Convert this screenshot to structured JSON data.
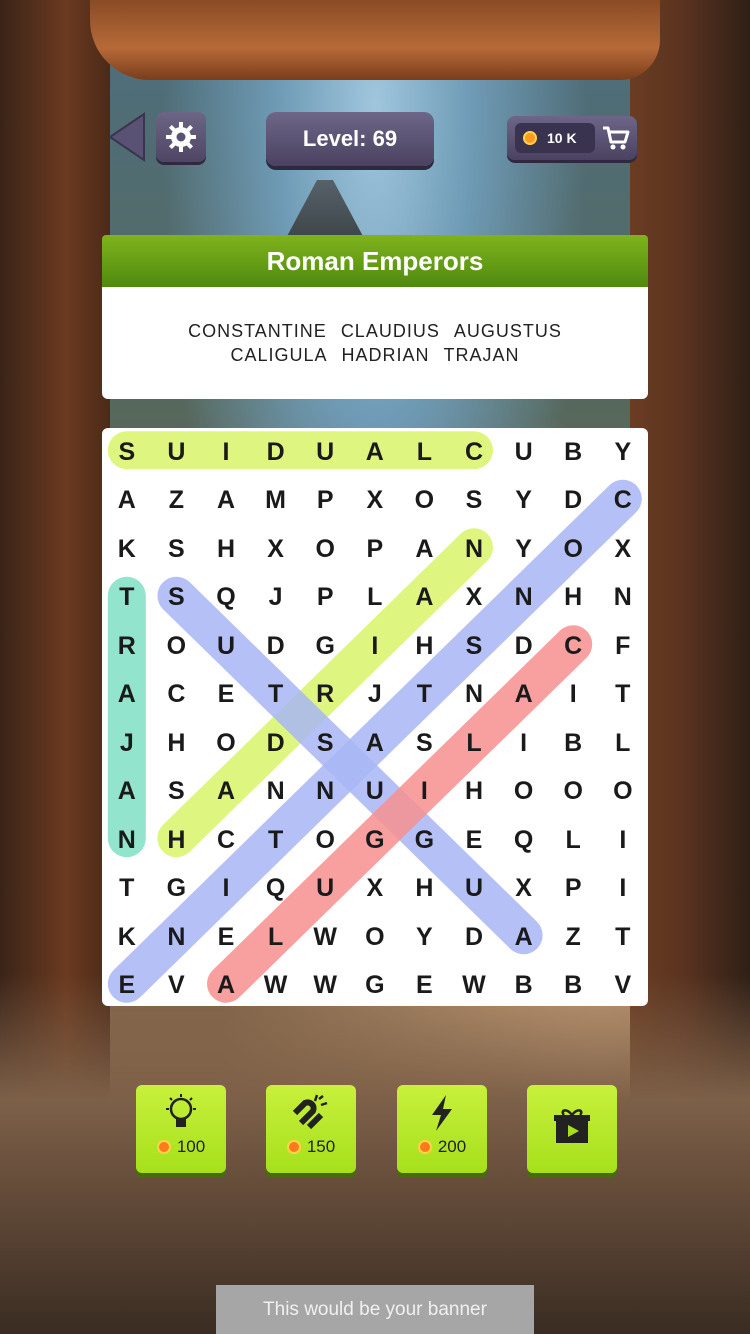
{
  "header": {
    "level_label": "Level: 69",
    "coins": "10 K"
  },
  "category": {
    "title": "Roman Emperors",
    "words_row1": [
      "CONSTANTINE",
      "CLAUDIUS",
      "AUGUSTUS"
    ],
    "words_row2": [
      "CALIGULA",
      "HADRIAN",
      "TRAJAN"
    ]
  },
  "grid": [
    [
      "S",
      "U",
      "I",
      "D",
      "U",
      "A",
      "L",
      "C",
      "U",
      "B",
      "Y"
    ],
    [
      "A",
      "Z",
      "A",
      "M",
      "P",
      "X",
      "O",
      "S",
      "Y",
      "D",
      "C"
    ],
    [
      "K",
      "S",
      "H",
      "X",
      "O",
      "P",
      "A",
      "N",
      "Y",
      "O",
      "X"
    ],
    [
      "T",
      "S",
      "Q",
      "J",
      "P",
      "L",
      "A",
      "X",
      "N",
      "H",
      "N"
    ],
    [
      "R",
      "O",
      "U",
      "D",
      "G",
      "I",
      "H",
      "S",
      "D",
      "C",
      "F"
    ],
    [
      "A",
      "C",
      "E",
      "T",
      "R",
      "J",
      "T",
      "N",
      "A",
      "I",
      "T"
    ],
    [
      "J",
      "H",
      "O",
      "D",
      "S",
      "A",
      "S",
      "L",
      "I",
      "B",
      "L"
    ],
    [
      "A",
      "S",
      "A",
      "N",
      "N",
      "U",
      "I",
      "H",
      "O",
      "O",
      "O"
    ],
    [
      "N",
      "H",
      "C",
      "T",
      "O",
      "G",
      "G",
      "E",
      "Q",
      "L",
      "I"
    ],
    [
      "T",
      "G",
      "I",
      "Q",
      "U",
      "X",
      "H",
      "U",
      "X",
      "P",
      "I"
    ],
    [
      "K",
      "N",
      "E",
      "L",
      "W",
      "O",
      "Y",
      "D",
      "A",
      "Z",
      "T"
    ],
    [
      "E",
      "V",
      "A",
      "W",
      "W",
      "G",
      "E",
      "W",
      "B",
      "B",
      "V"
    ]
  ],
  "highlights": [
    {
      "word": "CLAUDIUS",
      "color": "#d9f56a",
      "from": [
        0,
        7
      ],
      "to": [
        0,
        0
      ]
    },
    {
      "word": "TRAJAN",
      "color": "#7fe0c4",
      "from": [
        3,
        0
      ],
      "to": [
        8,
        0
      ]
    },
    {
      "word": "HADRIAN",
      "color": "#d9f56a",
      "from": [
        8,
        1
      ],
      "to": [
        2,
        7
      ]
    },
    {
      "word": "AUGUSTUS",
      "color": "#a9b7f5",
      "from": [
        10,
        8
      ],
      "to": [
        3,
        1
      ]
    },
    {
      "word": "CONSTANTINE",
      "color": "#a9b7f5",
      "from": [
        1,
        10
      ],
      "to": [
        11,
        0
      ]
    },
    {
      "word": "CALIGULA",
      "color": "#f79090",
      "from": [
        4,
        9
      ],
      "to": [
        11,
        2
      ]
    }
  ],
  "powerups": [
    {
      "icon": "lightbulb-icon",
      "price": "100"
    },
    {
      "icon": "magnet-icon",
      "price": "150"
    },
    {
      "icon": "lightning-icon",
      "price": "200"
    },
    {
      "icon": "gift-video-icon",
      "price": ""
    }
  ],
  "banner": "This would be your banner",
  "colors": {
    "accent": "#a6e01b",
    "panel": "#4a4260",
    "header_green": "#6aa517"
  }
}
